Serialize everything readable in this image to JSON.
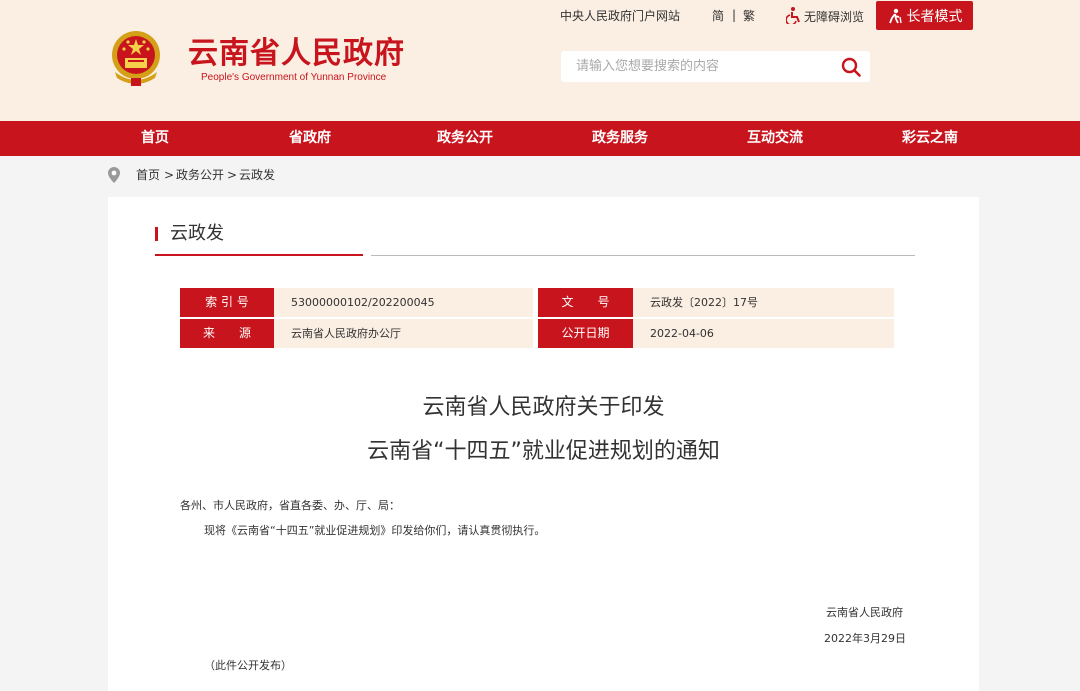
{
  "colors": {
    "brand_red": "#c8151d",
    "header_bg": "#fbeee2",
    "panel_bg": "#ffffff",
    "page_bg": "#f4f4f4"
  },
  "header": {
    "title": "云南省人民政府",
    "subtitle": "People's Government of Yunnan Province",
    "links": {
      "central_portal": "中央人民政府门户网站",
      "simplified": "简",
      "separator": "|",
      "traditional": "繁",
      "accessible": "无障碍浏览",
      "elder_mode": "长者模式"
    },
    "search": {
      "placeholder": "请输入您想要搜索的内容",
      "icon": "search-icon"
    }
  },
  "nav": {
    "items": [
      "首页",
      "省政府",
      "政务公开",
      "政务服务",
      "互动交流",
      "彩云之南"
    ]
  },
  "breadcrumb": {
    "items": [
      "首页",
      "政务公开",
      "云政发"
    ],
    "separator": ">"
  },
  "section": {
    "title": "云政发"
  },
  "meta": {
    "index_label": "索 引 号",
    "index_value": "53000000102/202200045",
    "doc_no_label": "文　　号",
    "doc_no_value": "云政发〔2022〕17号",
    "source_label": "来　　源",
    "source_value": "云南省人民政府办公厅",
    "date_label": "公开日期",
    "date_value": "2022-04-06"
  },
  "document": {
    "title_line1": "云南省人民政府关于印发",
    "title_line2": "云南省“十四五”就业促进规划的通知",
    "salutation": "各州、市人民政府，省直各委、办、厅、局：",
    "body": "现将《云南省“十四五”就业促进规划》印发给你们，请认真贯彻执行。",
    "signature": "云南省人民政府",
    "date": "2022年3月29日",
    "note": "（此件公开发布）"
  }
}
